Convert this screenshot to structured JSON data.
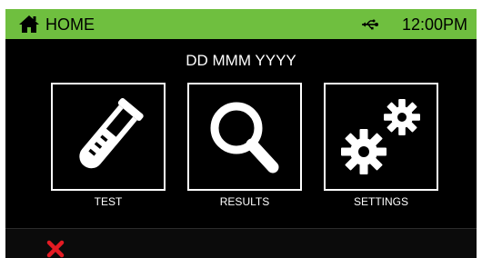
{
  "header": {
    "title": "HOME",
    "time": "12:00PM",
    "icons": {
      "home": "home-icon",
      "usb": "usb-icon"
    }
  },
  "date_text": "DD MMM YYYY",
  "tiles": [
    {
      "label": "TEST",
      "icon": "test-tube-icon"
    },
    {
      "label": "RESULTS",
      "icon": "magnifier-icon"
    },
    {
      "label": "SETTINGS",
      "icon": "gears-icon"
    }
  ],
  "footer": {
    "close_icon": "close-icon"
  },
  "colors": {
    "header_bg": "#6fbf3f",
    "screen_bg": "#000000",
    "text_light": "#ffffff",
    "close_red": "#e31b23"
  }
}
